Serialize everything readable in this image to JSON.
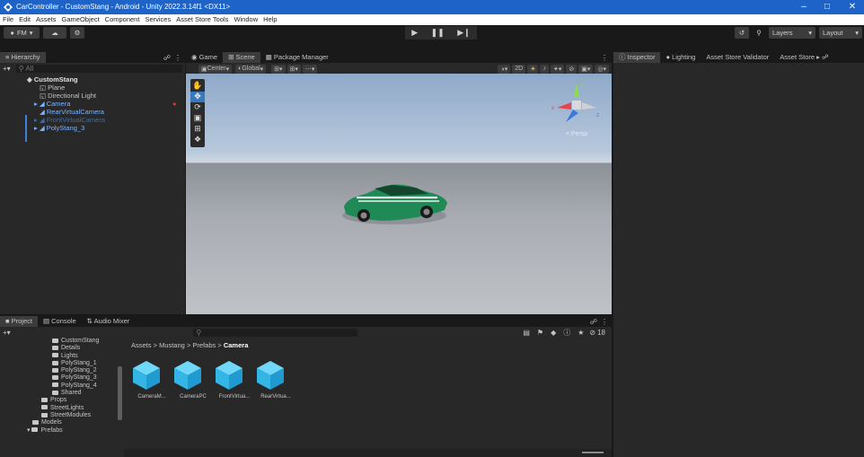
{
  "window": {
    "title": "CarController - CustomStang - Android - Unity 2022.3.14f1 <DX11>"
  },
  "menu": [
    "File",
    "Edit",
    "Assets",
    "GameObject",
    "Component",
    "Services",
    "Asset Store Tools",
    "Window",
    "Help"
  ],
  "toolbar": {
    "account": "FM",
    "layers": "Layers",
    "layout": "Layout"
  },
  "hierarchy": {
    "tab": "Hierarchy",
    "search_placeholder": "All",
    "scene": "CustomStang",
    "items": [
      "Plane",
      "Directional Light",
      "Camera",
      "RearVirtualCamera",
      "FrontVirtualCamera",
      "PolyStang_3"
    ]
  },
  "center_tabs": [
    "Game",
    "Scene",
    "Package Manager"
  ],
  "scene_toolbar": {
    "pivot": "Center",
    "space": "Global",
    "mode2d": "2D"
  },
  "scene_gizmo": {
    "label": "< Persp"
  },
  "right_tabs": [
    "Inspector",
    "Lighting",
    "Asset Store Validator",
    "Asset Store"
  ],
  "bottom_tabs": [
    "Project",
    "Console",
    "Audio Mixer"
  ],
  "project": {
    "folders": [
      "CustomStang",
      "Details",
      "Lights",
      "PolyStang_1",
      "PolyStang_2",
      "PolyStang_3",
      "PolyStang_4",
      "Shared",
      "Props",
      "StreetLights",
      "StreetModules",
      "Models",
      "Prefabs"
    ],
    "breadcrumb": [
      "Assets",
      "Mustang",
      "Prefabs",
      "Camera"
    ],
    "assets": [
      "CameraM...",
      "CameraPC",
      "FrontVirtua...",
      "RearVirtua..."
    ],
    "hidden_count": "18"
  },
  "colors": {
    "accent": "#1e64c8",
    "selection": "#2c5d87",
    "car": "#1f8a55"
  }
}
